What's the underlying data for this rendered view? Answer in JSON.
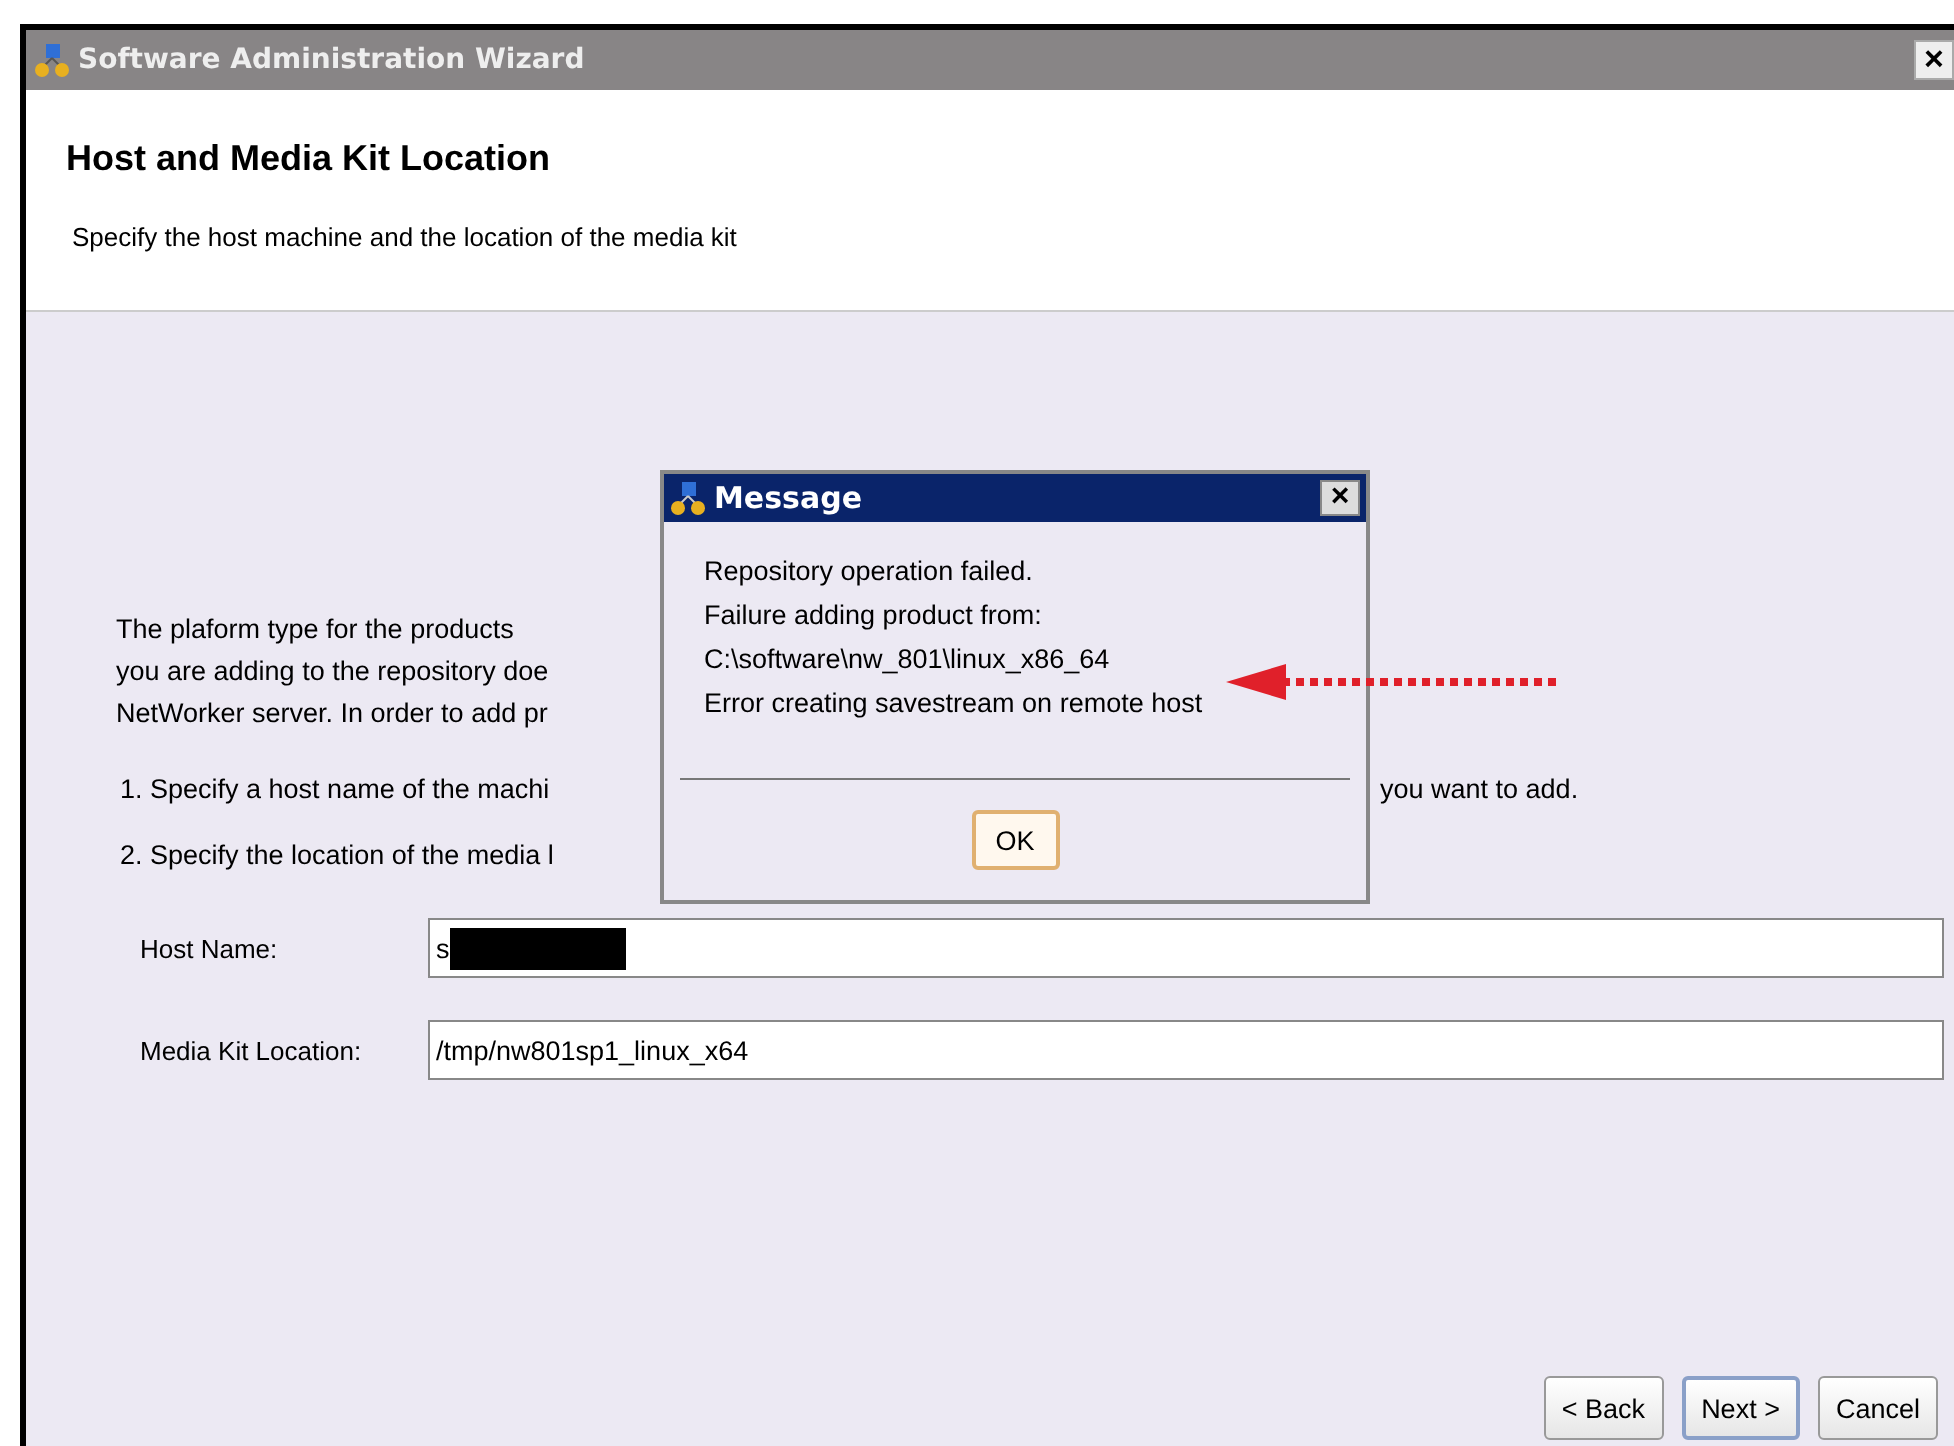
{
  "window": {
    "title": "Software Administration Wizard",
    "close": "×"
  },
  "header": {
    "title": "Host and Media Kit Location",
    "subtitle": "Specify the host machine and the location of the media kit"
  },
  "body": {
    "paragraph_lines": [
      "The plaform type for the products",
      "you are adding to the repository doe",
      "NetWorker server. In order to add pr"
    ],
    "steps": [
      {
        "text": "1. Specify a host name of the machi",
        "tail": "you want to add."
      },
      {
        "text": "2. Specify the location of the media l"
      }
    ]
  },
  "fields": [
    {
      "label": "Host Name:",
      "value": "s",
      "redacted": true
    },
    {
      "label": "Media Kit Location:",
      "value": "/tmp/nw801sp1_linux_x64",
      "redacted": false
    }
  ],
  "buttons": [
    {
      "label": "< Back",
      "default": false
    },
    {
      "label": "Next >",
      "default": true
    },
    {
      "label": "Cancel",
      "default": false
    }
  ],
  "dialog": {
    "title": "Message",
    "close": "×",
    "lines": [
      "Repository operation failed.",
      "Failure adding product from:",
      "C:\\software\\nw_801\\linux_x86_64",
      "Error creating savestream on remote host"
    ],
    "button": "OK"
  }
}
